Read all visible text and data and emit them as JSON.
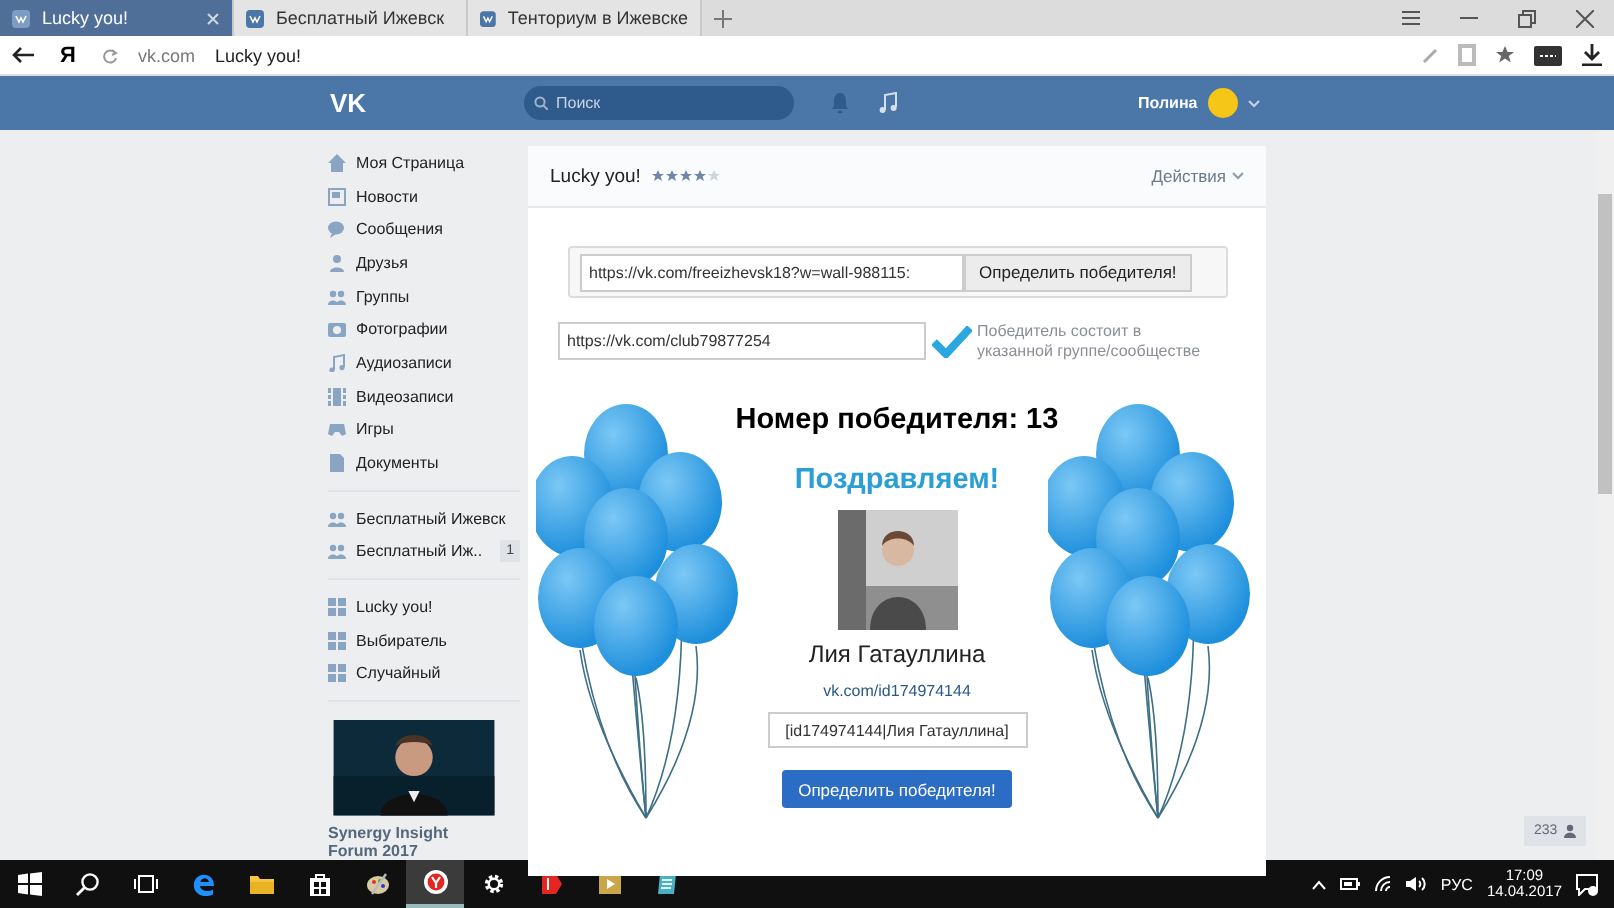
{
  "browser": {
    "tabs": [
      {
        "label": "Lucky you!",
        "selected": true
      },
      {
        "label": "Бесплатный Ижевск",
        "selected": false
      },
      {
        "label": "Тенториум в Ижевске",
        "selected": false
      }
    ],
    "logo": "Я",
    "address": {
      "domain": "vk.com",
      "title": "Lucky you!"
    }
  },
  "header": {
    "logo": "VK",
    "search": {
      "placeholder": "Поиск"
    },
    "user": "Полина"
  },
  "sidebar": {
    "sections": [
      [
        {
          "kind": "home",
          "label": "Моя Страница"
        },
        {
          "kind": "news",
          "label": "Новости"
        },
        {
          "kind": "messages",
          "label": "Сообщения"
        },
        {
          "kind": "friends",
          "label": "Друзья"
        },
        {
          "kind": "groups",
          "label": "Группы"
        },
        {
          "kind": "photos",
          "label": "Фотографии"
        },
        {
          "kind": "audio",
          "label": "Аудиозаписи"
        },
        {
          "kind": "video",
          "label": "Видеозаписи"
        },
        {
          "kind": "games",
          "label": "Игры"
        },
        {
          "kind": "docs",
          "label": "Документы"
        }
      ],
      [
        {
          "kind": "groups",
          "label": "Бесплатный Ижевск"
        },
        {
          "kind": "groups",
          "label": "Бесплатный Иж..",
          "count": "1"
        }
      ],
      [
        {
          "kind": "app",
          "label": "Lucky you!"
        },
        {
          "kind": "app",
          "label": "Выбиратель"
        },
        {
          "kind": "app",
          "label": "Случайный"
        }
      ]
    ],
    "ad": {
      "kind": "picture",
      "title": "Synergy Insight Forum 2017"
    }
  },
  "app": {
    "title": "Lucky you!",
    "stars": 4,
    "actions": "Действия",
    "post_url": "https://vk.com/freeizhevsk18?w=wall-988115:",
    "pick_button": "Определить победителя!",
    "group_url": "https://vk.com/club79877254",
    "member_check": {
      "checked": true,
      "label": "Победитель состоит в указанной группе/сообществе"
    },
    "winner_number": "Номер победителя: 13",
    "congrats": "Поздравляем!",
    "winner_name": "Лия Гатауллина",
    "winner_link": "vk.com/id174974144",
    "winner_code": "[id174974144|Лия Гатауллина]",
    "bottom_button": "Определить победителя!"
  },
  "online_count": "233",
  "taskbar": {
    "apps": [
      {
        "kind": "edge",
        "active": false
      },
      {
        "kind": "folder",
        "active": false
      },
      {
        "kind": "store",
        "active": false
      },
      {
        "kind": "paint",
        "active": false
      },
      {
        "kind": "yandex",
        "active": true
      },
      {
        "kind": "gear",
        "active": false
      },
      {
        "kind": "ya",
        "active": false
      },
      {
        "kind": "media",
        "active": false
      },
      {
        "kind": "notes",
        "active": false
      }
    ],
    "lang": "РУС",
    "time": "17:09",
    "date": "14.04.2017"
  }
}
